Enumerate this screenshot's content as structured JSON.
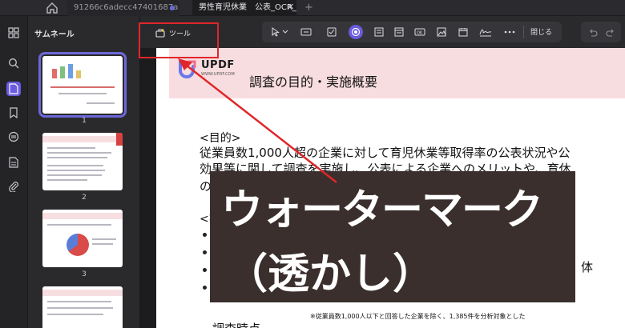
{
  "tabs": [
    {
      "label": "91266c6adecc47401687a"
    },
    {
      "label": "男性育児休業　公表_OCR_O"
    }
  ],
  "sidebar": {
    "title": "サムネール",
    "pages": [
      "1",
      "2",
      "3"
    ]
  },
  "toolbar": {
    "tool_label": "ツール",
    "close_label": "閉じる"
  },
  "document": {
    "logo_text": "UPDF",
    "logo_sub": "WWW.UPDF.COM",
    "title": "調査の目的・実施概要",
    "purpose_heading": "<目的>",
    "line1": "従業員数1,000人超の企業に対して育児休業等取得率の公表状況や公",
    "line2": "効果等に関して調査を実施し、公表による企業へのメリットや、育休",
    "line3": "の",
    "overview_heading": "<実",
    "tail_text": "体",
    "note": "※従業員数1,000人以下と回答した企業を除く、1,385件を分析対象とした",
    "bottom_label": "調査時点"
  },
  "watermark": {
    "line1": "ウォーターマーク",
    "line2": "（透かし）"
  },
  "colors": {
    "accent": "#6a5be0",
    "highlight_red": "#e0262a",
    "band_pink": "#f8dde0"
  }
}
